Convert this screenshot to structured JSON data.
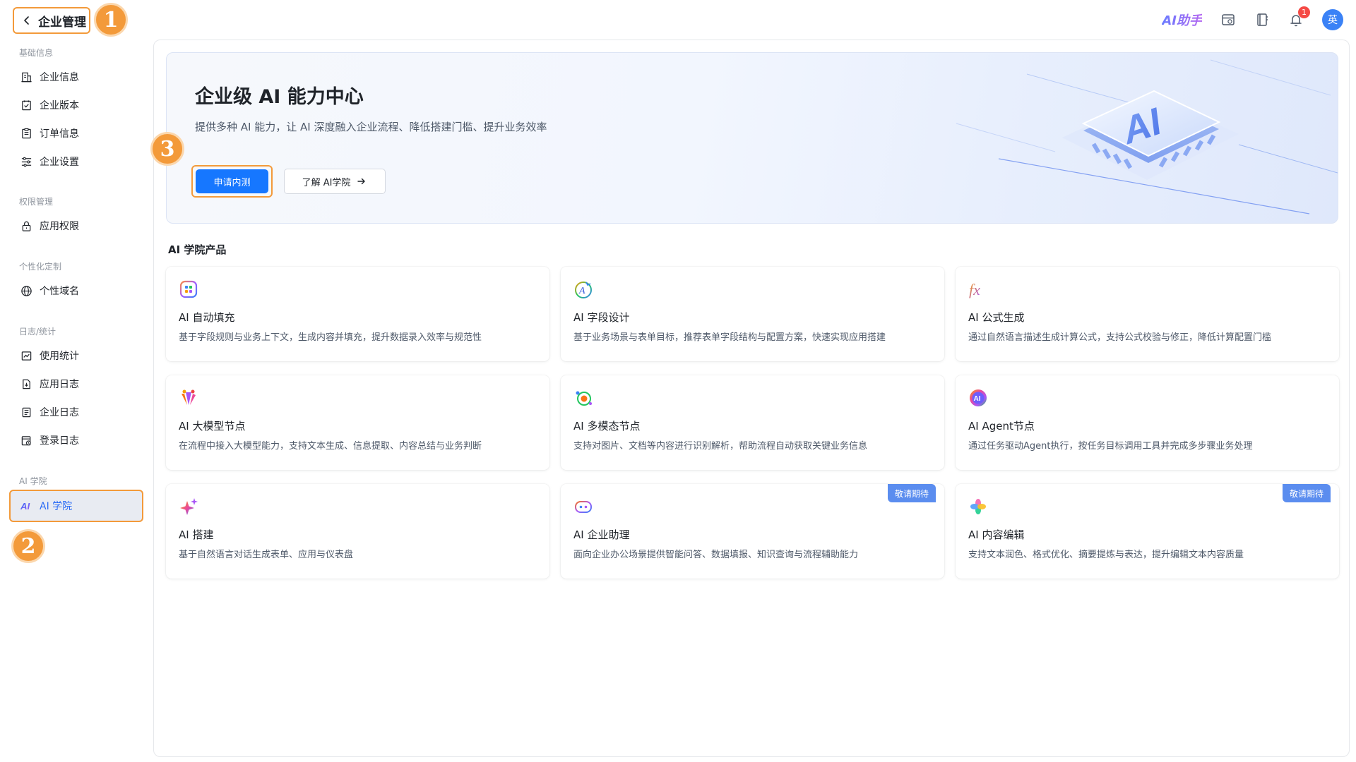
{
  "topbar": {
    "back_label": "企业管理",
    "ai_helper": "AI助手",
    "notification_count": "1",
    "avatar_text": "英"
  },
  "annotations": {
    "one": "1",
    "two": "2",
    "three": "3"
  },
  "sidebar": {
    "groups": [
      {
        "title": "基础信息",
        "items": [
          {
            "label": "企业信息",
            "icon": "building-icon"
          },
          {
            "label": "企业版本",
            "icon": "version-icon"
          },
          {
            "label": "订单信息",
            "icon": "order-icon"
          },
          {
            "label": "企业设置",
            "icon": "settings-sliders-icon"
          }
        ]
      },
      {
        "title": "权限管理",
        "items": [
          {
            "label": "应用权限",
            "icon": "lock-icon"
          }
        ]
      },
      {
        "title": "个性化定制",
        "items": [
          {
            "label": "个性域名",
            "icon": "globe-icon"
          }
        ]
      },
      {
        "title": "日志/统计",
        "items": [
          {
            "label": "使用统计",
            "icon": "chart-icon"
          },
          {
            "label": "应用日志",
            "icon": "app-log-icon"
          },
          {
            "label": "企业日志",
            "icon": "company-log-icon"
          },
          {
            "label": "登录日志",
            "icon": "login-log-icon"
          }
        ]
      },
      {
        "title": "AI 学院",
        "items": [
          {
            "label": "AI 学院",
            "icon": "ai-icon",
            "active": true
          }
        ]
      }
    ]
  },
  "hero": {
    "title": "企业级 AI 能力中心",
    "subtitle": "提供多种 AI 能力，让 AI 深度融入企业流程、降低搭建门槛、提升业务效率",
    "apply_label": "申请内测",
    "learn_label": "了解 AI学院"
  },
  "section_title": "AI 学院产品",
  "cards": [
    {
      "title": "AI 自动填充",
      "desc": "基于字段规则与业务上下文，生成内容并填充，提升数据录入效率与规范性",
      "icon": "auto-fill-icon"
    },
    {
      "title": "AI 字段设计",
      "desc": "基于业务场景与表单目标，推荐表单字段结构与配置方案，快速实现应用搭建",
      "icon": "field-design-icon"
    },
    {
      "title": "AI 公式生成",
      "desc": "通过自然语言描述生成计算公式，支持公式校验与修正，降低计算配置门槛",
      "icon": "formula-icon"
    },
    {
      "title": "AI 大模型节点",
      "desc": "在流程中接入大模型能力，支持文本生成、信息提取、内容总结与业务判断",
      "icon": "llm-node-icon"
    },
    {
      "title": "AI 多模态节点",
      "desc": "支持对图片、文档等内容进行识别解析，帮助流程自动获取关键业务信息",
      "icon": "multimodal-icon"
    },
    {
      "title": "AI Agent节点",
      "desc": "通过任务驱动Agent执行，按任务目标调用工具并完成多步骤业务处理",
      "icon": "agent-icon"
    },
    {
      "title": "AI 搭建",
      "desc": "基于自然语言对话生成表单、应用与仪表盘",
      "icon": "sparkle-icon"
    },
    {
      "title": "AI 企业助理",
      "desc": "面向企业办公场景提供智能问答、数据填报、知识查询与流程辅助能力",
      "icon": "assistant-icon",
      "tag": "敬请期待"
    },
    {
      "title": "AI 内容编辑",
      "desc": "支持文本润色、格式优化、摘要提炼与表达，提升编辑文本内容质量",
      "icon": "content-edit-icon",
      "tag": "敬请期待"
    }
  ],
  "colors": {
    "primary": "#1677ff",
    "annotation": "#f39a3a",
    "tag": "#5b8def"
  }
}
